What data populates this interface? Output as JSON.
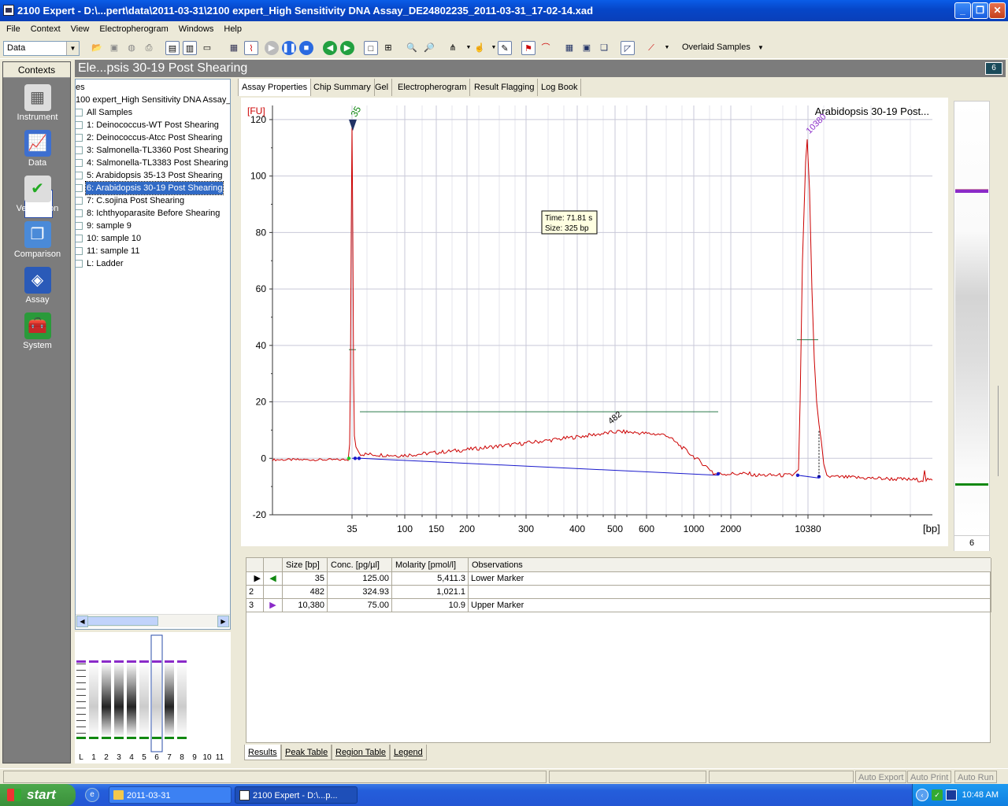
{
  "window": {
    "title": "2100 Expert - D:\\...pert\\data\\2011-03-31\\2100 expert_High Sensitivity DNA Assay_DE24802235_2011-03-31_17-02-14.xad"
  },
  "menu": [
    "File",
    "Context",
    "View",
    "Electropherogram",
    "Windows",
    "Help"
  ],
  "toolbar": {
    "context_combo": "Data",
    "view_combo": "Overlaid Samples"
  },
  "contexts": {
    "header": "Contexts",
    "items": [
      "Instrument",
      "Data",
      "Verification",
      "Comparison",
      "Assay",
      "System"
    ],
    "selected": "Data"
  },
  "tree": {
    "rows": [
      "es",
      "100 expert_High Sensitivity DNA Assay_",
      "All Samples",
      "1: Deinococcus-WT Post Shearing",
      "2: Deinococcus-Atcc Post Shearing",
      "3: Salmonella-TL3360 Post Shearing",
      "4: Salmonella-TL3383 Post Shearing",
      "5: Arabidopsis 35-13 Post Shearing",
      "6: Arabidopsis 30-19 Post Shearing",
      "7: C.sojina Post Shearing",
      "8: Ichthyoparasite Before Shearing",
      "9: sample 9",
      "10: sample 10",
      "11: sample 11",
      "L: Ladder"
    ],
    "selected_index": 8
  },
  "gel_thumbs": {
    "labels": [
      "L",
      "1",
      "2",
      "3",
      "4",
      "5",
      "6",
      "7",
      "8",
      "9",
      "10",
      "11"
    ],
    "selected": "6"
  },
  "panel": {
    "title": "Ele...psis 30-19 Post Shearing",
    "tabs": [
      "Assay Properties",
      "Chip Summary",
      "Gel",
      "Electropherogram",
      "Result Flagging",
      "Log Book"
    ]
  },
  "chart_data": {
    "type": "line",
    "title": "Arabidopsis 30-19 Post...",
    "ylabel": "[FU]",
    "xlabel": "[bp]",
    "ylim": [
      -20,
      125
    ],
    "yticks": [
      -20,
      0,
      20,
      40,
      60,
      80,
      100,
      120
    ],
    "xticks": [
      "35",
      "100",
      "150",
      "200",
      "300",
      "400",
      "500",
      "600",
      "1000",
      "2000",
      "10380"
    ],
    "peaks": [
      {
        "label": "35",
        "size_bp": 35,
        "height_fu": 118
      },
      {
        "label": "482",
        "size_bp": 482,
        "height_fu": 10
      },
      {
        "label": "10380",
        "size_bp": 10380,
        "height_fu": 113
      }
    ],
    "tooltip": {
      "time": "Time: 71.81 s",
      "size": "Size: 325 bp"
    },
    "grid": true,
    "color": "#cc0000"
  },
  "gel_lane": {
    "label": "6"
  },
  "peak_table": {
    "columns": [
      "Size [bp]",
      "Conc. [pg/µl]",
      "Molarity [pmol/l]",
      "Observations"
    ],
    "rows": [
      {
        "row": "",
        "size": "35",
        "conc": "125.00",
        "molarity": "5,411.3",
        "obs": "Lower Marker"
      },
      {
        "row": "2",
        "size": "482",
        "conc": "324.93",
        "molarity": "1,021.1",
        "obs": ""
      },
      {
        "row": "3",
        "size": "10,380",
        "conc": "75.00",
        "molarity": "10.9",
        "obs": "Upper Marker"
      }
    ]
  },
  "bottom_tabs": [
    "Results",
    "Peak Table",
    "Region Table",
    "Legend"
  ],
  "status": {
    "auto_export": "Auto Export",
    "auto_print": "Auto Print",
    "auto_run": "Auto Run"
  },
  "taskbar": {
    "start": "start",
    "tasks": [
      "2011-03-31",
      "2100 Expert - D:\\...p..."
    ],
    "clock": "10:48 AM"
  }
}
